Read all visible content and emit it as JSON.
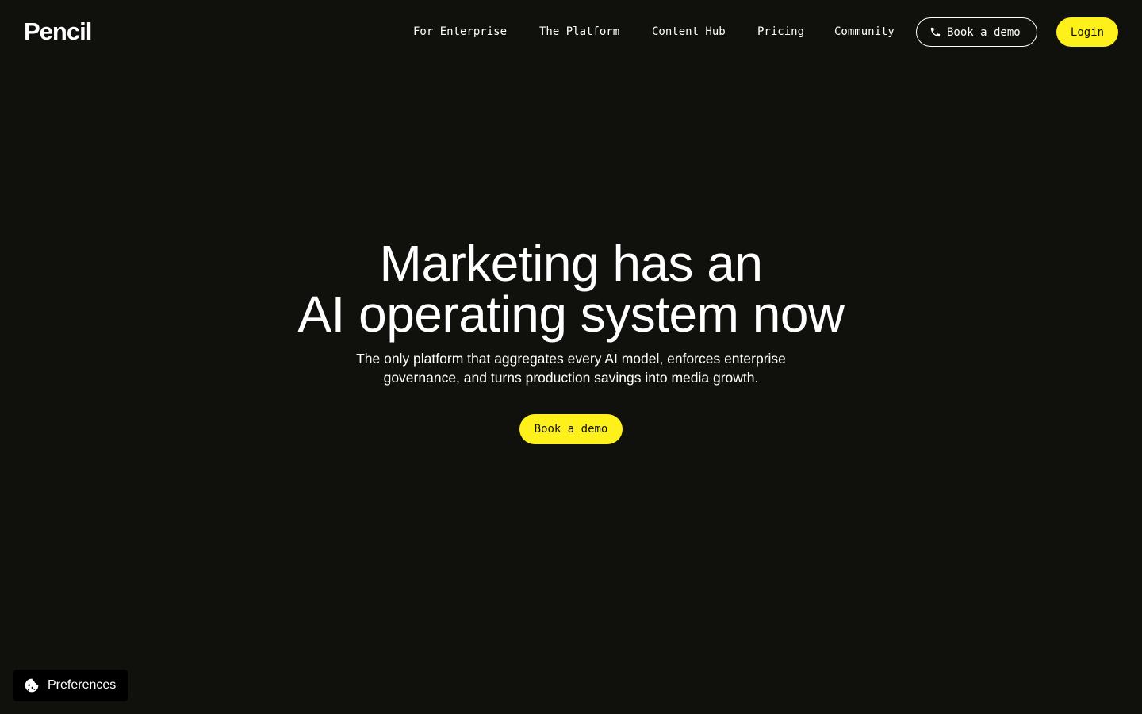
{
  "brand": {
    "logo_text": "Pencil"
  },
  "nav": {
    "items": [
      {
        "label": "For Enterprise"
      },
      {
        "label": "The Platform"
      },
      {
        "label": "Content Hub"
      },
      {
        "label": "Pricing"
      },
      {
        "label": "Community"
      }
    ],
    "book_demo_label": "Book a demo",
    "book_demo_icon": "phone-icon",
    "login_label": "Login"
  },
  "hero": {
    "title_line1": "Marketing has an",
    "title_line2": "AI operating system now",
    "subtitle_line1": "The only platform that aggregates every AI model, enforces enterprise",
    "subtitle_line2": "governance, and turns production savings into media growth.",
    "cta_label": "Book a demo"
  },
  "preferences": {
    "label": "Preferences",
    "icon": "cookie-icon"
  },
  "colors": {
    "background": "#10100c",
    "accent": "#fef01a",
    "text": "#ffffff"
  }
}
